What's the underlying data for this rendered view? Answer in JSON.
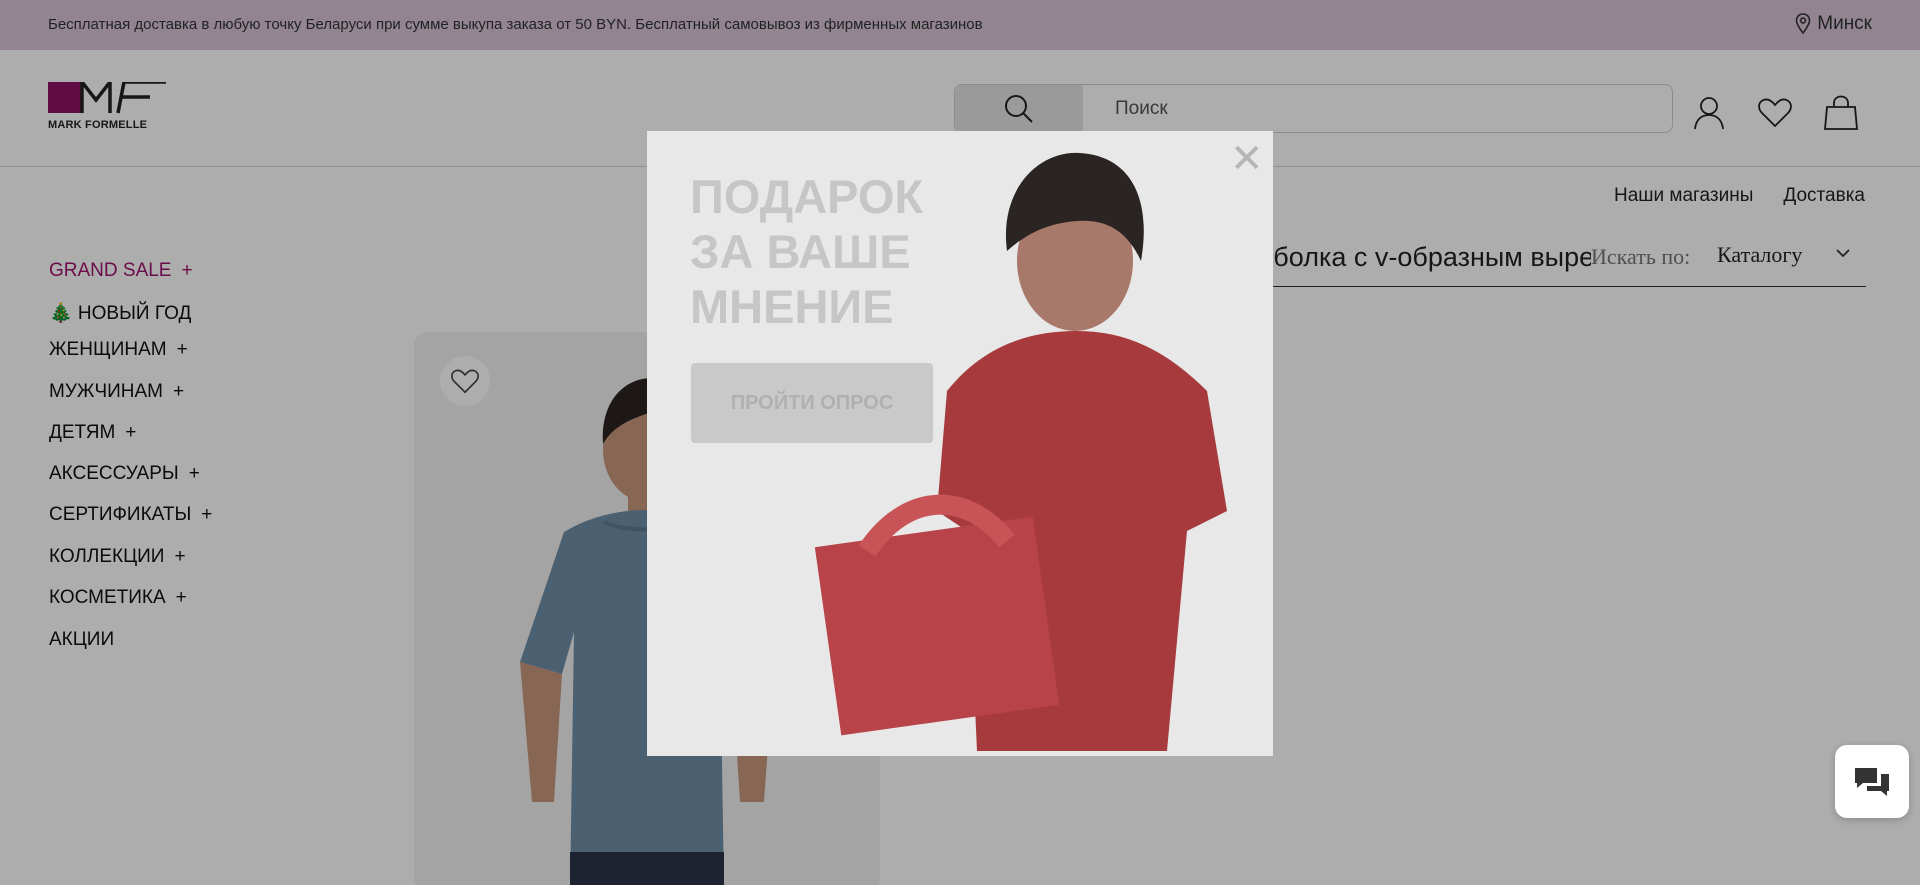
{
  "topbar": {
    "text": "Бесплатная доставка в любую точку Беларуси при сумме выкупа заказа от 50 BYN. Бесплатный самовывоз из фирменных магазинов",
    "city": "Минск"
  },
  "header": {
    "logo_text": "MARK FORMELLE",
    "search_placeholder": "Поиск"
  },
  "toplinks": [
    "Наши магазины",
    "Доставка"
  ],
  "menu": [
    {
      "label": "GRAND SALE",
      "plus": "+"
    },
    {
      "label": "🎄 НОВЫЙ ГОД",
      "plus": ""
    },
    {
      "label": "ЖЕНЩИНАМ",
      "plus": "+"
    },
    {
      "label": "МУЖЧИНАМ",
      "plus": "+"
    },
    {
      "label": "ДЕТЯМ",
      "plus": "+"
    },
    {
      "label": "АКСЕССУАРЫ",
      "plus": "+"
    },
    {
      "label": "СЕРТИФИКАТЫ",
      "plus": "+"
    },
    {
      "label": "КОЛЛЕКЦИИ",
      "plus": "+"
    },
    {
      "label": "КОСМЕТИКА",
      "plus": "+"
    },
    {
      "label": "АКЦИИ",
      "plus": ""
    }
  ],
  "catalog_search": {
    "query": "Однотонная футболка с v-образным вырезом",
    "search_by_label": "Искать по:",
    "search_by_value": "Каталогу"
  },
  "popup": {
    "title": "ПОДАРОК ЗА ВАШЕ МНЕНИЕ",
    "button": "ПРОЙТИ ОПРОС",
    "close": "✕"
  },
  "colors": {
    "brand": "#8e1266",
    "sale": "#a0126e",
    "topbar": "#d7c5d6"
  }
}
